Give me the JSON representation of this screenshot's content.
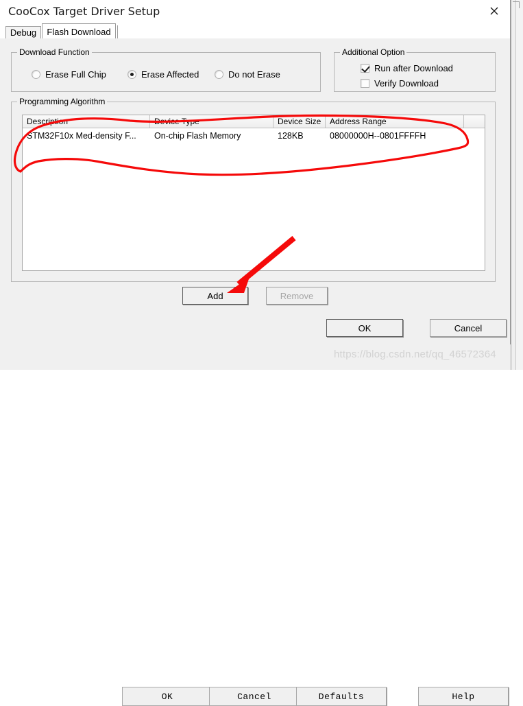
{
  "window": {
    "title": "CooCox Target Driver Setup",
    "close_icon": "close-icon"
  },
  "tabs": [
    {
      "label": "Debug",
      "selected": false
    },
    {
      "label": "Flash Download",
      "selected": true
    }
  ],
  "download_function": {
    "legend": "Download Function",
    "options": [
      {
        "label": "Erase Full Chip",
        "selected": false
      },
      {
        "label": "Erase Affected",
        "selected": true
      },
      {
        "label": "Do not Erase",
        "selected": false
      }
    ]
  },
  "additional_option": {
    "legend": "Additional Option",
    "options": [
      {
        "label": "Run after Download",
        "checked": true
      },
      {
        "label": "Verify Download",
        "checked": false
      }
    ]
  },
  "programming_algorithm": {
    "legend": "Programming Algorithm",
    "columns": [
      "Description",
      "Device Type",
      "Device Size",
      "Address Range",
      ""
    ],
    "rows": [
      {
        "description": "STM32F10x Med-density F...",
        "device_type": "On-chip Flash Memory",
        "device_size": "128KB",
        "address_range": "08000000H--0801FFFFH",
        "extra": ""
      }
    ],
    "buttons": {
      "add": "Add",
      "remove": "Remove"
    }
  },
  "dialog_buttons": {
    "ok": "OK",
    "cancel": "Cancel"
  },
  "background_window": {
    "buttons": {
      "ok": "OK",
      "cancel": "Cancel",
      "defaults": "Defaults",
      "help": "Help"
    }
  },
  "annotations": {
    "ellipse_color": "#f90606",
    "arrow_color": "#f50a0a",
    "arrow_target": "Add"
  },
  "watermark": {
    "text": "https://blog.csdn.net/qq_46572364"
  },
  "colors": {
    "dialog_background": "#f0f0f0",
    "titlebar_background": "#ffffff",
    "listbox_background": "#ffffff",
    "annotation_red": "#f50a0a"
  }
}
